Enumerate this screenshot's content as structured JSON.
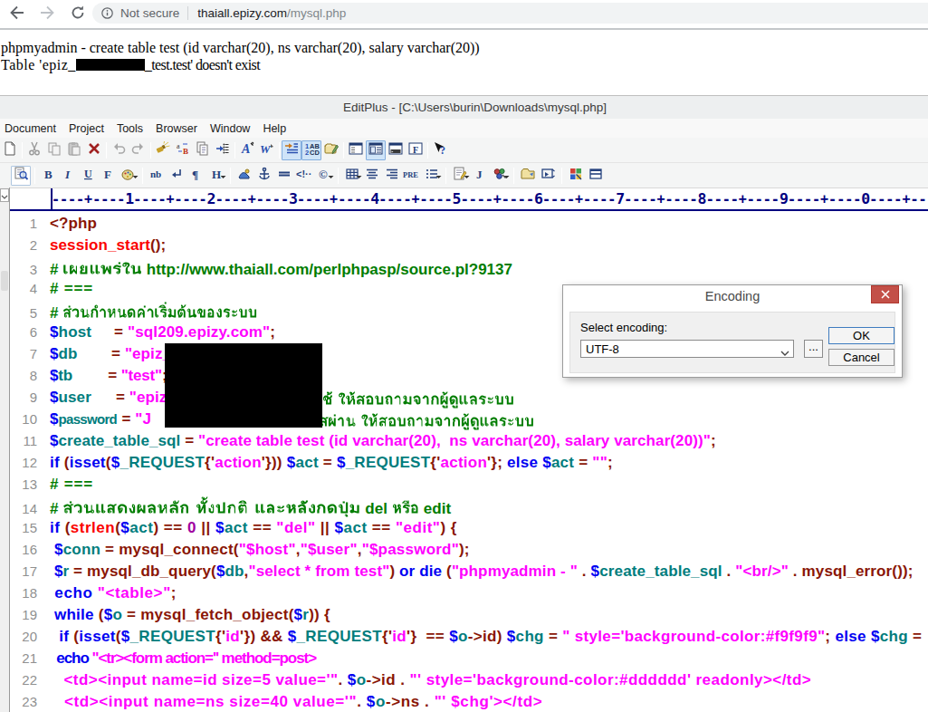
{
  "browser": {
    "back_icon": "back-arrow",
    "forward_icon": "forward-arrow",
    "reload_icon": "reload",
    "security_label": "Not secure",
    "url_domain": "thaiall.epizy.com",
    "url_path": "/mysql.php"
  },
  "page_output": {
    "line1": "phpmyadmin - create table test (id varchar(20), ns varchar(20), salary varchar(20))",
    "line2_prefix": "Table 'epiz_",
    "line2_redacted": true,
    "line2_suffix": "_test.test' doesn't exist"
  },
  "editplus": {
    "title": "EditPlus - [C:\\Users\\burin\\Downloads\\mysql.php]",
    "menu": [
      "Document",
      "Project",
      "Tools",
      "Browser",
      "Window",
      "Help"
    ],
    "toolbar1": [
      {
        "icon": "new-document",
        "partial": true
      },
      {
        "sep": true
      },
      {
        "icon": "cut",
        "disabled": true
      },
      {
        "icon": "copy",
        "disabled": true
      },
      {
        "icon": "paste",
        "disabled": true
      },
      {
        "icon": "delete"
      },
      {
        "sep": true
      },
      {
        "icon": "undo",
        "disabled": true
      },
      {
        "icon": "redo",
        "disabled": true
      },
      {
        "sep": true
      },
      {
        "icon": "find"
      },
      {
        "icon": "replace"
      },
      {
        "icon": "find-in-files"
      },
      {
        "icon": "goto-line"
      },
      {
        "sep": true
      },
      {
        "icon": "font"
      },
      {
        "icon": "word-wrap"
      },
      {
        "sep": true
      },
      {
        "icon": "auto-indent",
        "selected": true
      },
      {
        "icon": "line-numbers",
        "selected": true
      },
      {
        "icon": "preferences"
      },
      {
        "sep": true
      },
      {
        "icon": "window-cliptext"
      },
      {
        "icon": "window-directory",
        "selected": true
      },
      {
        "icon": "window-output"
      },
      {
        "icon": "window-function"
      },
      {
        "sep": true
      },
      {
        "icon": "context-help"
      }
    ],
    "toolbar2": [
      {
        "icon": "browser-preview",
        "bordered": true
      },
      {
        "sep": true
      },
      {
        "icon": "html-bold"
      },
      {
        "icon": "html-italic"
      },
      {
        "icon": "html-underline"
      },
      {
        "icon": "html-font"
      },
      {
        "icon": "html-color",
        "dropdown": true
      },
      {
        "sep": true
      },
      {
        "icon": "html-nbsp"
      },
      {
        "icon": "html-break"
      },
      {
        "icon": "html-paragraph"
      },
      {
        "icon": "html-heading",
        "dropdown": true
      },
      {
        "sep": true
      },
      {
        "icon": "html-image"
      },
      {
        "icon": "html-anchor"
      },
      {
        "icon": "html-hrule"
      },
      {
        "icon": "html-comment"
      },
      {
        "icon": "html-special-char",
        "dropdown": true
      },
      {
        "sep": true
      },
      {
        "icon": "html-table",
        "dropdown": true
      },
      {
        "icon": "html-align-center"
      },
      {
        "icon": "html-align-right"
      },
      {
        "icon": "html-pre"
      },
      {
        "icon": "html-list",
        "dropdown": true
      },
      {
        "sep": true
      },
      {
        "icon": "html-script",
        "dropdown": true
      },
      {
        "icon": "html-javascript"
      },
      {
        "icon": "html-objects",
        "dropdown": true
      },
      {
        "sep": true
      },
      {
        "icon": "html-form"
      },
      {
        "icon": "html-frame"
      },
      {
        "sep": true
      },
      {
        "icon": "html-colors"
      },
      {
        "icon": "html-split"
      }
    ],
    "ruler_digits": [
      "1",
      "2",
      "3",
      "4",
      "5",
      "6",
      "7",
      "8",
      "9",
      "0"
    ],
    "lines": [
      {
        "n": 1,
        "segs": [
          {
            "t": "<?php",
            "c": "p"
          }
        ]
      },
      {
        "n": 2,
        "segs": [
          {
            "t": "session_start",
            "c": "f"
          },
          {
            "t": "();",
            "c": "p"
          }
        ]
      },
      {
        "n": 3,
        "segs": [
          {
            "t": "# ",
            "c": "m"
          },
          {
            "t": "เผยแพร่ใน",
            "c": "m",
            "thai": true
          },
          {
            "t": " http://www.thaiall.com/perlphpasp/source.pl?9137",
            "c": "m"
          }
        ],
        "ls": -0.11
      },
      {
        "n": 4,
        "segs": [
          {
            "t": "# ===",
            "c": "m"
          }
        ],
        "ls": 0.71
      },
      {
        "n": 5,
        "segs": [
          {
            "t": "# ",
            "c": "m"
          },
          {
            "t": "ส่วนกำหนดค่าเริ่มต้นของระบบ",
            "c": "m",
            "thai": true
          }
        ]
      },
      {
        "n": 6,
        "segs": [
          {
            "t": "$",
            "c": "k"
          },
          {
            "t": "host",
            "c": "v"
          },
          {
            "t": "    ",
            "c": "p",
            "w": 25.0
          },
          {
            "t": "= ",
            "c": "p"
          },
          {
            "t": "\"sql209.epizy.com\"",
            "c": "s"
          },
          {
            "t": ";",
            "c": "p"
          }
        ],
        "ls": 0.04
      },
      {
        "n": 7,
        "segs": [
          {
            "t": "$",
            "c": "k"
          },
          {
            "t": "db",
            "c": "v"
          },
          {
            "t": "      ",
            "c": "p",
            "w": 37.5
          },
          {
            "t": "= ",
            "c": "p"
          },
          {
            "t": "\"epiz_",
            "c": "s"
          }
        ]
      },
      {
        "n": 8,
        "segs": [
          {
            "t": "$",
            "c": "k"
          },
          {
            "t": "tb",
            "c": "v"
          },
          {
            "t": "     ",
            "c": "p",
            "w": 39.3
          },
          {
            "t": "= ",
            "c": "p"
          },
          {
            "t": "\"test\"",
            "c": "s"
          },
          {
            "t": ";",
            "c": "p"
          }
        ],
        "ls": -0.27
      },
      {
        "n": 9,
        "segs": [
          {
            "t": "$",
            "c": "k"
          },
          {
            "t": "user",
            "c": "v"
          },
          {
            "t": "    ",
            "c": "p",
            "w": 27.1
          },
          {
            "t": "= ",
            "c": "p"
          },
          {
            "t": "\"epiz",
            "c": "s"
          },
          {
            "t": "ช้ ให้สอบถามจากผู้ดูแลระบบ",
            "c": "m",
            "thai": true,
            "abs": 345
          }
        ]
      },
      {
        "n": 10,
        "segs": [
          {
            "t": "$",
            "c": "k"
          },
          {
            "t": "password",
            "c": "v",
            "fs": 15,
            "ls": -0.7
          },
          {
            "t": " ",
            "c": "p",
            "w": 5.5
          },
          {
            "t": "= ",
            "c": "p"
          },
          {
            "t": "\"J",
            "c": "s"
          },
          {
            "t": "สผ่าน ให้สอบถามจากผู้ดูแลระบบ",
            "c": "m",
            "thai": true,
            "abs": 341
          }
        ]
      },
      {
        "n": 11,
        "segs": [
          {
            "t": "$",
            "c": "k"
          },
          {
            "t": "create_table_sql",
            "c": "v"
          },
          {
            "t": " = ",
            "c": "p"
          },
          {
            "t": "\"create table test (id varchar(20),  ns varchar(20), salary varchar(20))\"",
            "c": "s"
          },
          {
            "t": ";",
            "c": "p"
          }
        ]
      },
      {
        "n": 12,
        "segs": [
          {
            "t": "if",
            "c": "k"
          },
          {
            "t": " (",
            "c": "p"
          },
          {
            "t": "isset",
            "c": "k"
          },
          {
            "t": "(",
            "c": "p"
          },
          {
            "t": "$",
            "c": "k"
          },
          {
            "t": "_REQUEST",
            "c": "v"
          },
          {
            "t": "{'",
            "c": "p"
          },
          {
            "t": "action",
            "c": "s"
          },
          {
            "t": "'})) ",
            "c": "p"
          },
          {
            "t": "$",
            "c": "k"
          },
          {
            "t": "act",
            "c": "v"
          },
          {
            "t": " = ",
            "c": "p"
          },
          {
            "t": "$",
            "c": "k"
          },
          {
            "t": "_REQUEST",
            "c": "v"
          },
          {
            "t": "{'",
            "c": "p"
          },
          {
            "t": "action",
            "c": "s"
          },
          {
            "t": "'}; ",
            "c": "p"
          },
          {
            "t": "else",
            "c": "k"
          },
          {
            "t": " ",
            "c": "p"
          },
          {
            "t": "$",
            "c": "k"
          },
          {
            "t": "act",
            "c": "v"
          },
          {
            "t": " = ",
            "c": "p"
          },
          {
            "t": "\"\"",
            "c": "s"
          },
          {
            "t": ";",
            "c": "p"
          }
        ],
        "ls": 0.15
      },
      {
        "n": 13,
        "segs": [
          {
            "t": "# ===",
            "c": "m"
          }
        ],
        "ls": 0.71
      },
      {
        "n": 14,
        "segs": [
          {
            "t": "# ",
            "c": "m"
          },
          {
            "t": "ส่วนแสดงผลหลัก ทั้งปกติ และหลังกดปุ่ม",
            "c": "m",
            "thai": true
          },
          {
            "t": " del ",
            "c": "m"
          },
          {
            "t": "หรือ",
            "c": "m",
            "thai": true
          },
          {
            "t": " edit",
            "c": "m"
          }
        ]
      },
      {
        "n": 15,
        "segs": [
          {
            "t": "if",
            "c": "k"
          },
          {
            "t": " (",
            "c": "p"
          },
          {
            "t": "strlen",
            "c": "f"
          },
          {
            "t": "(",
            "c": "p"
          },
          {
            "t": "$",
            "c": "k"
          },
          {
            "t": "act",
            "c": "v"
          },
          {
            "t": ") == ",
            "c": "p"
          },
          {
            "t": "0",
            "c": "n"
          },
          {
            "t": " || ",
            "c": "p"
          },
          {
            "t": "$",
            "c": "k"
          },
          {
            "t": "act",
            "c": "v"
          },
          {
            "t": " == ",
            "c": "p"
          },
          {
            "t": "\"del\"",
            "c": "s"
          },
          {
            "t": " || ",
            "c": "p"
          },
          {
            "t": "$",
            "c": "k"
          },
          {
            "t": "act",
            "c": "v"
          },
          {
            "t": " == ",
            "c": "p"
          },
          {
            "t": "\"edit\"",
            "c": "s"
          },
          {
            "t": ") {",
            "c": "p"
          }
        ],
        "ls": 0.41
      },
      {
        "n": 16,
        "segs": [
          {
            "t": " ",
            "c": "p"
          },
          {
            "t": "$",
            "c": "k"
          },
          {
            "t": "conn",
            "c": "v"
          },
          {
            "t": " = mysql_connect(",
            "c": "p"
          },
          {
            "t": "\"$host\"",
            "c": "s"
          },
          {
            "t": ",",
            "c": "p"
          },
          {
            "t": "\"$user\"",
            "c": "s"
          },
          {
            "t": ",",
            "c": "p"
          },
          {
            "t": "\"$password\"",
            "c": "s"
          },
          {
            "t": ");",
            "c": "p"
          }
        ],
        "ls": 0.12
      },
      {
        "n": 17,
        "segs": [
          {
            "t": " ",
            "c": "p"
          },
          {
            "t": "$",
            "c": "k"
          },
          {
            "t": "r",
            "c": "v"
          },
          {
            "t": " = mysql_db_query(",
            "c": "p"
          },
          {
            "t": "$",
            "c": "k"
          },
          {
            "t": "db",
            "c": "v"
          },
          {
            "t": ",",
            "c": "p"
          },
          {
            "t": "\"select * from test\"",
            "c": "s"
          },
          {
            "t": ") ",
            "c": "p"
          },
          {
            "t": "or",
            "c": "k"
          },
          {
            "t": " ",
            "c": "p"
          },
          {
            "t": "die",
            "c": "k"
          },
          {
            "t": " (",
            "c": "p"
          },
          {
            "t": "\"phpmyadmin - \"",
            "c": "s"
          },
          {
            "t": " . ",
            "c": "p"
          },
          {
            "t": "$",
            "c": "k"
          },
          {
            "t": "create_table_sql",
            "c": "v"
          },
          {
            "t": " . ",
            "c": "p"
          },
          {
            "t": "\"<br/>\"",
            "c": "s"
          },
          {
            "t": " . mysql_error());",
            "c": "p"
          }
        ],
        "ls": 0.04
      },
      {
        "n": 18,
        "segs": [
          {
            "t": " ",
            "c": "p"
          },
          {
            "t": "echo",
            "c": "k"
          },
          {
            "t": " ",
            "c": "p"
          },
          {
            "t": "\"<table>\"",
            "c": "s"
          },
          {
            "t": ";",
            "c": "p"
          }
        ],
        "ls": 0.5
      },
      {
        "n": 19,
        "segs": [
          {
            "t": " ",
            "c": "p"
          },
          {
            "t": "while",
            "c": "k"
          },
          {
            "t": " (",
            "c": "p"
          },
          {
            "t": "$",
            "c": "k"
          },
          {
            "t": "o",
            "c": "v"
          },
          {
            "t": " = mysql_fetch_object(",
            "c": "p"
          },
          {
            "t": "$",
            "c": "k"
          },
          {
            "t": "r",
            "c": "v"
          },
          {
            "t": ")) {",
            "c": "p"
          }
        ],
        "ls": 0.16
      },
      {
        "n": 20,
        "segs": [
          {
            "t": "  ",
            "c": "p"
          },
          {
            "t": "if",
            "c": "k"
          },
          {
            "t": " (",
            "c": "p"
          },
          {
            "t": "isset",
            "c": "k"
          },
          {
            "t": "(",
            "c": "p"
          },
          {
            "t": "$",
            "c": "k"
          },
          {
            "t": "_REQUEST",
            "c": "v"
          },
          {
            "t": "{'",
            "c": "p"
          },
          {
            "t": "id",
            "c": "s"
          },
          {
            "t": "'}) && ",
            "c": "p"
          },
          {
            "t": "$",
            "c": "k"
          },
          {
            "t": "_REQUEST",
            "c": "v"
          },
          {
            "t": "{'",
            "c": "p"
          },
          {
            "t": "id",
            "c": "s"
          },
          {
            "t": "'}  == ",
            "c": "p"
          },
          {
            "t": "$",
            "c": "k"
          },
          {
            "t": "o",
            "c": "v"
          },
          {
            "t": "->id) ",
            "c": "p"
          },
          {
            "t": "$",
            "c": "k"
          },
          {
            "t": "chg",
            "c": "v"
          },
          {
            "t": " = ",
            "c": "p"
          },
          {
            "t": "\" style='background-color:#f9f9f9\"",
            "c": "s"
          },
          {
            "t": "; ",
            "c": "p"
          },
          {
            "t": "else",
            "c": "k"
          },
          {
            "t": " ",
            "c": "p"
          },
          {
            "t": "$",
            "c": "k"
          },
          {
            "t": "chg",
            "c": "v"
          },
          {
            "t": " =",
            "c": "p"
          }
        ],
        "ls": 0.24
      },
      {
        "n": 21,
        "segs": [
          {
            "t": "  ",
            "c": "p"
          },
          {
            "t": "echo",
            "c": "k"
          },
          {
            "t": " ",
            "c": "p"
          },
          {
            "t": "\"<tr><form action='' method=post>",
            "c": "s"
          }
        ],
        "ls": -1.16
      },
      {
        "n": 22,
        "segs": [
          {
            "t": "   ",
            "c": "p"
          },
          {
            "t": "<td><input name=id size=5 value='\"",
            "c": "s"
          },
          {
            "t": ". ",
            "c": "p"
          },
          {
            "t": "$",
            "c": "k"
          },
          {
            "t": "o",
            "c": "v"
          },
          {
            "t": "->id . ",
            "c": "p"
          },
          {
            "t": "\"' style='background-color:#dddddd' readonly></td>",
            "c": "s"
          }
        ],
        "ls": 0.34
      },
      {
        "n": 23,
        "segs": [
          {
            "t": "   ",
            "c": "p"
          },
          {
            "t": "<td><input name=ns size=40 value='\"",
            "c": "s"
          },
          {
            "t": ". ",
            "c": "p"
          },
          {
            "t": "$",
            "c": "k"
          },
          {
            "t": "o",
            "c": "v"
          },
          {
            "t": "->ns . ",
            "c": "p"
          },
          {
            "t": "\"' $chg'></td>",
            "c": "s"
          }
        ],
        "ls": 0.5
      }
    ]
  },
  "dialog": {
    "title": "Encoding",
    "close_icon": "close",
    "label": "Select encoding:",
    "value": "UTF-8",
    "browse_label": "...",
    "ok_label": "OK",
    "cancel_label": "Cancel"
  },
  "colors": {
    "code_plain": "#8a1606",
    "code_keyword": "#0000f2",
    "code_variable": "#007d7d",
    "code_string": "#ff00ff",
    "code_function": "#fb0200",
    "code_comment": "#007d00",
    "code_number": "#a000a0",
    "ruler": "#000080",
    "selected_toolbar_bg": "#cfe4f8"
  }
}
